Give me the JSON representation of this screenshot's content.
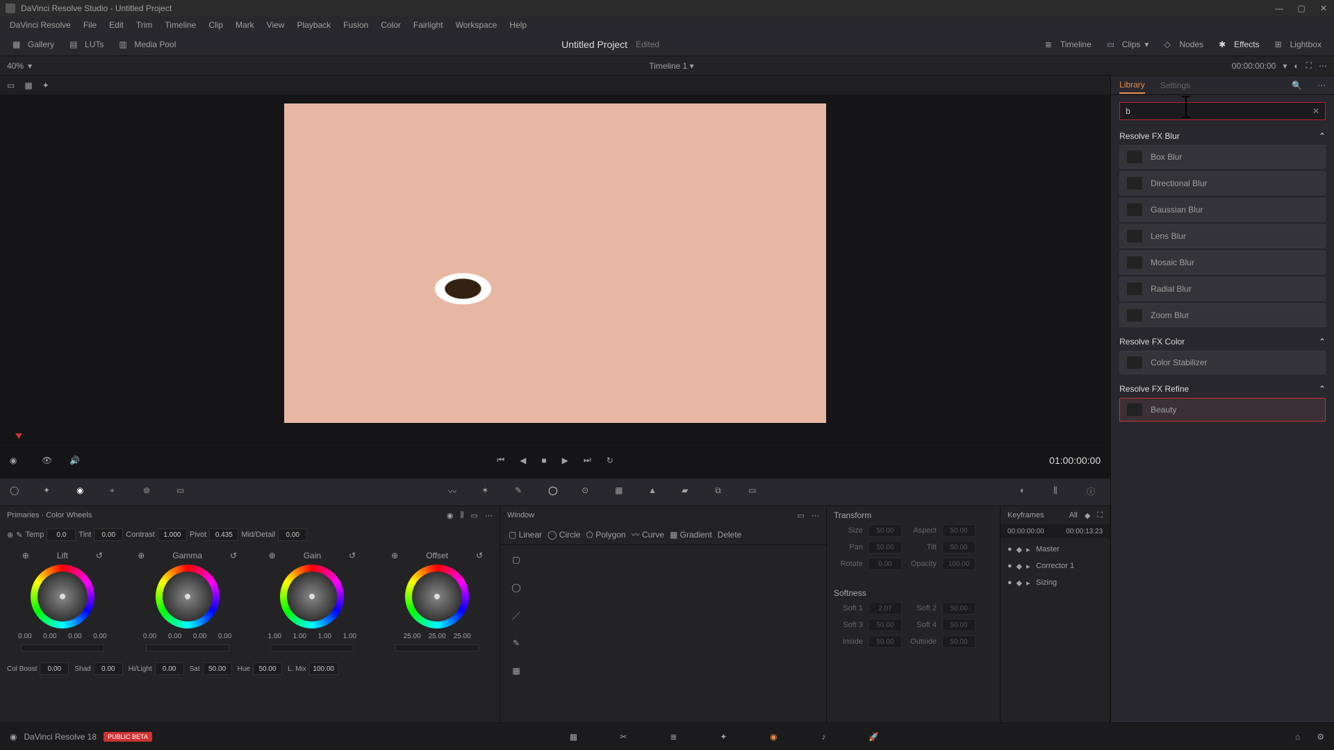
{
  "titlebar": {
    "title": "DaVinci Resolve Studio - Untitled Project"
  },
  "menubar": [
    "DaVinci Resolve",
    "File",
    "Edit",
    "Trim",
    "Timeline",
    "Clip",
    "Mark",
    "View",
    "Playback",
    "Fusion",
    "Color",
    "Fairlight",
    "Workspace",
    "Help"
  ],
  "topstrip": {
    "left": [
      {
        "icon": "gallery",
        "label": "Gallery"
      },
      {
        "icon": "luts",
        "label": "LUTs"
      },
      {
        "icon": "media",
        "label": "Media Pool"
      }
    ],
    "project": "Untitled Project",
    "project_status": "Edited",
    "right": [
      {
        "icon": "timeline",
        "label": "Timeline"
      },
      {
        "icon": "clips",
        "label": "Clips"
      },
      {
        "icon": "nodes",
        "label": "Nodes"
      },
      {
        "icon": "effects",
        "label": "Effects"
      },
      {
        "icon": "lightbox",
        "label": "Lightbox"
      }
    ]
  },
  "viewer": {
    "zoom": "40%",
    "timeline_name": "Timeline 1",
    "tc_in": "00:00:00:00",
    "tc_display": "01:00:00:00"
  },
  "primaries": {
    "title": "Primaries · Color Wheels",
    "top_row": {
      "temp": {
        "label": "Temp",
        "value": "0.0"
      },
      "tint": {
        "label": "Tint",
        "value": "0.00"
      },
      "contrast": {
        "label": "Contrast",
        "value": "1.000"
      },
      "pivot": {
        "label": "Pivot",
        "value": "0.435"
      },
      "middetail": {
        "label": "Mid/Detail",
        "value": "0.00"
      }
    },
    "wheels": [
      {
        "name": "Lift",
        "vals": [
          "0.00",
          "0.00",
          "0.00",
          "0.00"
        ]
      },
      {
        "name": "Gamma",
        "vals": [
          "0.00",
          "0.00",
          "0.00",
          "0.00"
        ]
      },
      {
        "name": "Gain",
        "vals": [
          "1.00",
          "1.00",
          "1.00",
          "1.00"
        ]
      },
      {
        "name": "Offset",
        "vals": [
          "25.00",
          "25.00",
          "25.00"
        ]
      }
    ],
    "bottom_row": {
      "colboost": {
        "label": "Col Boost",
        "value": "0.00"
      },
      "shad": {
        "label": "Shad",
        "value": "0.00"
      },
      "hilight": {
        "label": "Hi/Light",
        "value": "0.00"
      },
      "sat": {
        "label": "Sat",
        "value": "50.00"
      },
      "hue": {
        "label": "Hue",
        "value": "50.00"
      },
      "lmix": {
        "label": "L. Mix",
        "value": "100.00"
      }
    }
  },
  "window_panel": {
    "title": "Window",
    "tools": [
      "Linear",
      "Circle",
      "Polygon",
      "Curve",
      "Gradient",
      "Delete"
    ]
  },
  "transform": {
    "title": "Transform",
    "rows": [
      {
        "l1": "Size",
        "v1": "50.00",
        "l2": "Aspect",
        "v2": "50.00"
      },
      {
        "l1": "Pan",
        "v1": "50.00",
        "l2": "Tilt",
        "v2": "50.00"
      },
      {
        "l1": "Rotate",
        "v1": "0.00",
        "l2": "Opacity",
        "v2": "100.00"
      }
    ],
    "softness_title": "Softness",
    "soft_rows": [
      {
        "l1": "Soft 1",
        "v1": "2.07",
        "l2": "Soft 2",
        "v2": "50.00"
      },
      {
        "l1": "Soft 3",
        "v1": "50.00",
        "l2": "Soft 4",
        "v2": "50.00"
      },
      {
        "l1": "Inside",
        "v1": "50.00",
        "l2": "Outside",
        "v2": "50.00"
      }
    ]
  },
  "keyframes": {
    "title": "Keyframes",
    "filter": "All",
    "start_tc": "00:00:00:00",
    "end_tc": "00:00:13:23",
    "tracks": [
      "Master",
      "Corrector 1",
      "Sizing"
    ]
  },
  "library": {
    "tab_library": "Library",
    "tab_settings": "Settings",
    "search_value": "b",
    "sections": [
      {
        "name": "Resolve FX Blur",
        "items": [
          "Box Blur",
          "Directional Blur",
          "Gaussian Blur",
          "Lens Blur",
          "Mosaic Blur",
          "Radial Blur",
          "Zoom Blur"
        ]
      },
      {
        "name": "Resolve FX Color",
        "items": [
          "Color Stabilizer"
        ]
      },
      {
        "name": "Resolve FX Refine",
        "items": [
          "Beauty"
        ],
        "selected": 0
      }
    ]
  },
  "bottombar": {
    "version": "DaVinci Resolve 18",
    "beta": "PUBLIC BETA"
  }
}
